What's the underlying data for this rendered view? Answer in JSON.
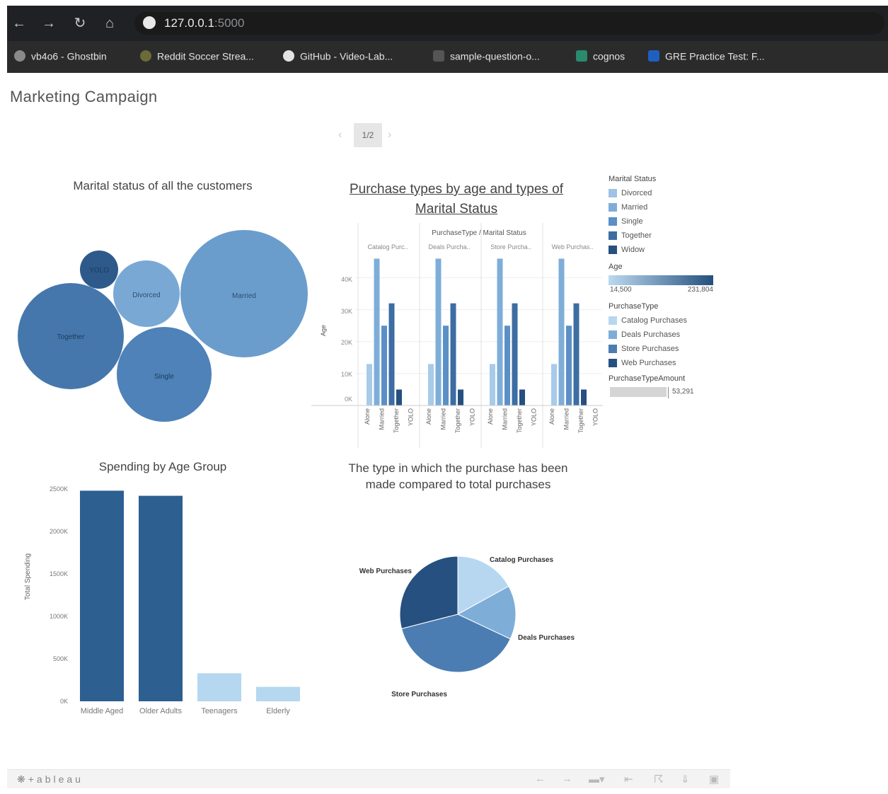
{
  "browser": {
    "url_host": "127.0.0.1",
    "url_port": ":5000",
    "bookmarks": [
      {
        "label": "vb4o6 - Ghostbin",
        "icon": "ghost-icon",
        "color": "#8a8a8a"
      },
      {
        "label": "Reddit Soccer Strea...",
        "icon": "soccer-icon",
        "color": "#6b6b3a"
      },
      {
        "label": "GitHub - Video-Lab...",
        "icon": "github-icon",
        "color": "#e3e3e3"
      },
      {
        "label": "sample-question-o...",
        "icon": "page-icon",
        "color": "#555555"
      },
      {
        "label": "cognos",
        "icon": "cognos-icon",
        "color": "#2a8a6e"
      },
      {
        "label": "GRE Practice Test: F...",
        "icon": "c-icon",
        "color": "#1f5fbf"
      }
    ]
  },
  "page": {
    "title": "Marketing Campaign",
    "pager": {
      "current": "1/2"
    }
  },
  "bubble": {
    "title": "Marital status of all the customers",
    "bubbles": [
      {
        "label": "YOLO",
        "color": "#2d5a8a"
      },
      {
        "label": "Divorced",
        "color": "#7aa8d4"
      },
      {
        "label": "Married",
        "color": "#6a9dcc"
      },
      {
        "label": "Together",
        "color": "#4577ad"
      },
      {
        "label": "Single",
        "color": "#4e82b8"
      }
    ]
  },
  "purchase_chart": {
    "title_line1": "Purchase types by age and types of",
    "title_line2": "Marital Status",
    "header": "PurchaseType / Marital Status",
    "panels": [
      "Catalog Purc..",
      "Deals Purcha..",
      "Store Purcha..",
      "Web Purchas.."
    ],
    "ylabel": "Age",
    "yticks": [
      "0K",
      "10K",
      "20K",
      "30K",
      "40K"
    ],
    "categories": [
      "Alone",
      "Married",
      "Together",
      "YOLO"
    ]
  },
  "legend": {
    "marital_title": "Marital Status",
    "marital": [
      {
        "label": "Divorced",
        "color": "#9dc3e6"
      },
      {
        "label": "Married",
        "color": "#7eaed8"
      },
      {
        "label": "Single",
        "color": "#5b8fc6"
      },
      {
        "label": "Together",
        "color": "#3c6da3"
      },
      {
        "label": "Widow",
        "color": "#27507e"
      }
    ],
    "age_title": "Age",
    "age_min": "14,500",
    "age_max": "231,804",
    "ptype_title": "PurchaseType",
    "ptype": [
      {
        "label": "Catalog Purchases",
        "color": "#b7d7f0"
      },
      {
        "label": "Deals Purchases",
        "color": "#7eaed8"
      },
      {
        "label": "Store Purchases",
        "color": "#4b7db3"
      },
      {
        "label": "Web Purchases",
        "color": "#25507f"
      }
    ],
    "amount_title": "PurchaseTypeAmount",
    "amount_value": "53,291"
  },
  "age_chart": {
    "title": "Spending by Age Group",
    "ylabel": "Total Spending",
    "yticks": [
      "0K",
      "500K",
      "1000K",
      "1500K",
      "2000K",
      "2500K"
    ]
  },
  "pie_chart": {
    "title_line1": "The type in which the purchase has been",
    "title_line2": "made compared to total purchases"
  },
  "chart_data": [
    {
      "type": "bar",
      "title": "Purchase types by age and types of Marital Status",
      "ylabel": "Age",
      "ylim": [
        0,
        45000
      ],
      "categories": [
        "Alone",
        "Married",
        "Together",
        "YOLO"
      ],
      "series": [
        {
          "name": "Catalog Purchases",
          "values": [
            13000,
            46000,
            25000,
            32000,
            5000
          ]
        },
        {
          "name": "Deals Purchases",
          "values": [
            13000,
            46000,
            25000,
            32000,
            5000
          ]
        },
        {
          "name": "Store Purchases",
          "values": [
            13000,
            46000,
            25000,
            32000,
            5000
          ]
        },
        {
          "name": "Web Purchases",
          "values": [
            13000,
            46000,
            25000,
            32000,
            5000
          ]
        }
      ]
    },
    {
      "type": "bar",
      "title": "Spending by Age Group",
      "ylabel": "Total Spending",
      "ylim": [
        0,
        2500000
      ],
      "categories": [
        "Middle Aged",
        "Older Adults",
        "Teenagers",
        "Elderly"
      ],
      "values": [
        2480000,
        2420000,
        330000,
        170000
      ],
      "colors": [
        "#2d5f90",
        "#2d5f90",
        "#b5d7f0",
        "#b5d7f0"
      ]
    },
    {
      "type": "pie",
      "title": "The type in which the purchase has been made compared to total purchases",
      "categories": [
        "Catalog Purchases",
        "Deals Purchases",
        "Store Purchases",
        "Web Purchases"
      ],
      "values": [
        17,
        15,
        39,
        29
      ],
      "colors": [
        "#b7d7f0",
        "#7eaed8",
        "#4b7db3",
        "#25507f"
      ]
    }
  ]
}
